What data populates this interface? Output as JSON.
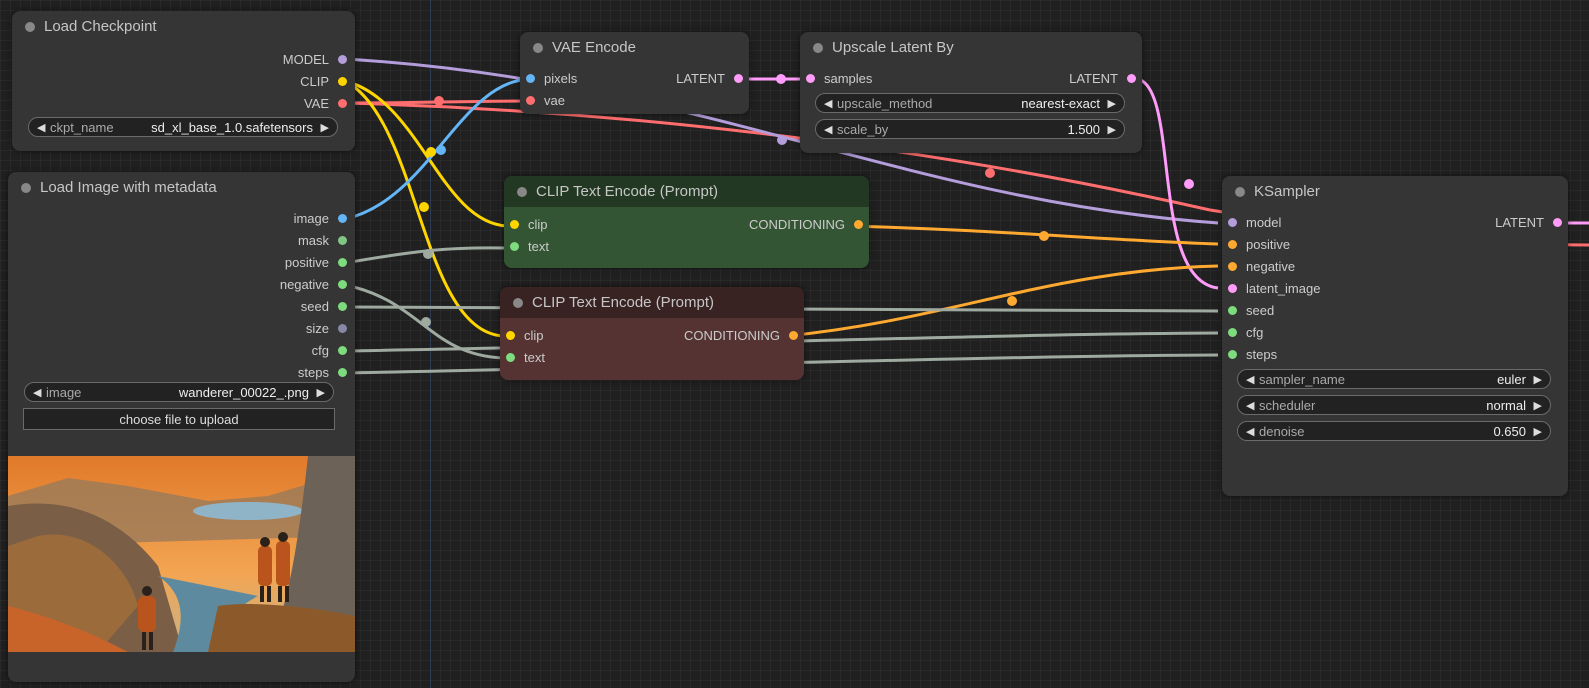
{
  "colors": {
    "model": "#b39ddb",
    "clip": "#ffd500",
    "vae": "#ff6e6e",
    "image": "#64b5f6",
    "mask": "#81c784",
    "latent": "#ff9cf9",
    "conditioning": "#ffa931",
    "int": "#9ea9a0",
    "green_slot": "#7ddc7d",
    "grey_slot": "#8888a6"
  },
  "nodes": {
    "load_checkpoint": {
      "title": "Load Checkpoint",
      "outputs": {
        "model": "MODEL",
        "clip": "CLIP",
        "vae": "VAE"
      },
      "widgets": {
        "ckpt_name": {
          "label": "ckpt_name",
          "value": "sd_xl_base_1.0.safetensors"
        }
      }
    },
    "load_image": {
      "title": "Load Image with metadata",
      "outputs": {
        "image": "image",
        "mask": "mask",
        "positive": "positive",
        "negative": "negative",
        "seed": "seed",
        "size": "size",
        "cfg": "cfg",
        "steps": "steps"
      },
      "widgets": {
        "image": {
          "label": "image",
          "value": "wanderer_00022_.png"
        }
      },
      "upload_label": "choose file to upload"
    },
    "vae_encode": {
      "title": "VAE Encode",
      "inputs": {
        "pixels": "pixels",
        "vae": "vae"
      },
      "outputs": {
        "latent": "LATENT"
      }
    },
    "upscale_latent": {
      "title": "Upscale Latent By",
      "inputs": {
        "samples": "samples"
      },
      "outputs": {
        "latent": "LATENT"
      },
      "widgets": {
        "upscale_method": {
          "label": "upscale_method",
          "value": "nearest-exact"
        },
        "scale_by": {
          "label": "scale_by",
          "value": "1.500"
        }
      }
    },
    "clip_pos": {
      "title": "CLIP Text Encode (Prompt)",
      "inputs": {
        "clip": "clip",
        "text": "text"
      },
      "outputs": {
        "conditioning": "CONDITIONING"
      }
    },
    "clip_neg": {
      "title": "CLIP Text Encode (Prompt)",
      "inputs": {
        "clip": "clip",
        "text": "text"
      },
      "outputs": {
        "conditioning": "CONDITIONING"
      }
    },
    "ksampler": {
      "title": "KSampler",
      "inputs": {
        "model": "model",
        "positive": "positive",
        "negative": "negative",
        "latent_image": "latent_image",
        "seed": "seed",
        "cfg": "cfg",
        "steps": "steps"
      },
      "outputs": {
        "latent": "LATENT"
      },
      "widgets": {
        "sampler_name": {
          "label": "sampler_name",
          "value": "euler"
        },
        "scheduler": {
          "label": "scheduler",
          "value": "normal"
        },
        "denoise": {
          "label": "denoise",
          "value": "0.650"
        }
      }
    }
  }
}
